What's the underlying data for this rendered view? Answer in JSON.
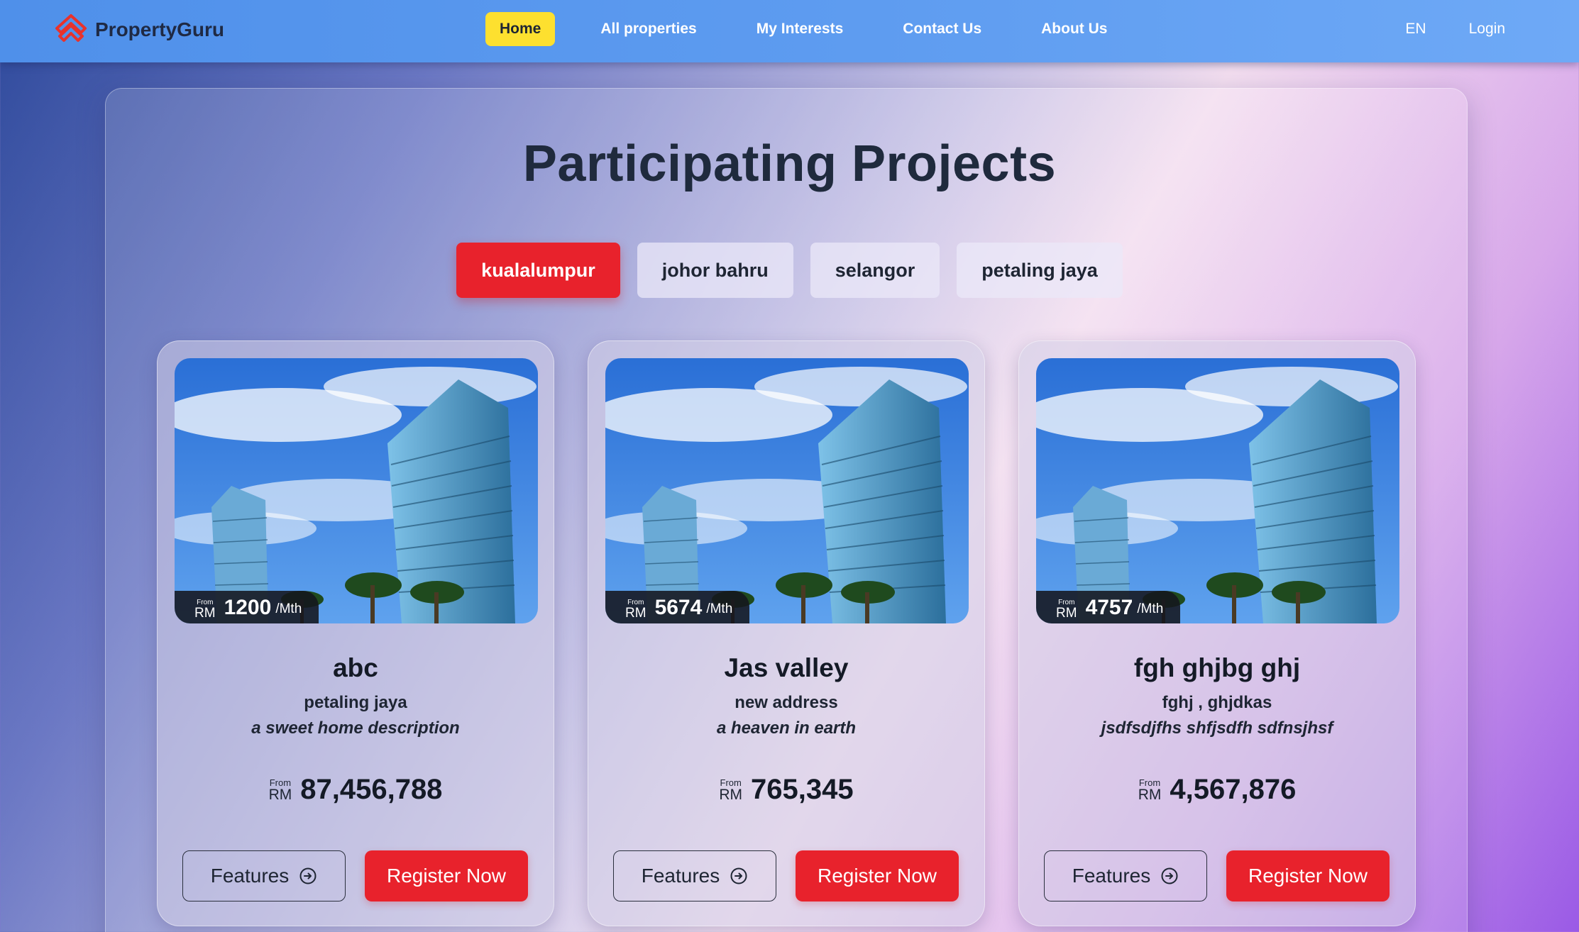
{
  "brand": {
    "name": "PropertyGuru"
  },
  "nav": {
    "links": [
      {
        "label": "Home",
        "active": true
      },
      {
        "label": "All properties",
        "active": false
      },
      {
        "label": "My Interests",
        "active": false
      },
      {
        "label": "Contact Us",
        "active": false
      },
      {
        "label": "About Us",
        "active": false
      }
    ],
    "language": "EN",
    "login": "Login"
  },
  "page": {
    "title": "Participating Projects"
  },
  "filters": [
    {
      "label": "kualalumpur",
      "active": true
    },
    {
      "label": "johor bahru",
      "active": false
    },
    {
      "label": "selangor",
      "active": false
    },
    {
      "label": "petaling jaya",
      "active": false
    }
  ],
  "projects": [
    {
      "name": "abc",
      "location": "petaling jaya",
      "description": "a sweet home description",
      "monthly": {
        "from": "From",
        "currency": "RM",
        "value": "1200",
        "unit": "/Mth"
      },
      "price": {
        "from": "From",
        "currency": "RM",
        "value": "87,456,788"
      },
      "features_label": "Features",
      "register_label": "Register Now"
    },
    {
      "name": "Jas valley",
      "location": "new address",
      "description": "a heaven in earth",
      "monthly": {
        "from": "From",
        "currency": "RM",
        "value": "5674",
        "unit": "/Mth"
      },
      "price": {
        "from": "From",
        "currency": "RM",
        "value": "765,345"
      },
      "features_label": "Features",
      "register_label": "Register Now"
    },
    {
      "name": "fgh ghjbg ghj",
      "location": "fghj , ghjdkas",
      "description": "jsdfsdjfhs shfjsdfh sdfnsjhsf",
      "monthly": {
        "from": "From",
        "currency": "RM",
        "value": "4757",
        "unit": "/Mth"
      },
      "price": {
        "from": "From",
        "currency": "RM",
        "value": "4,567,876"
      },
      "features_label": "Features",
      "register_label": "Register Now"
    }
  ],
  "colors": {
    "nav_active": "#fde02f",
    "accent_red": "#e8222c",
    "title_text": "#1f2a3d"
  }
}
